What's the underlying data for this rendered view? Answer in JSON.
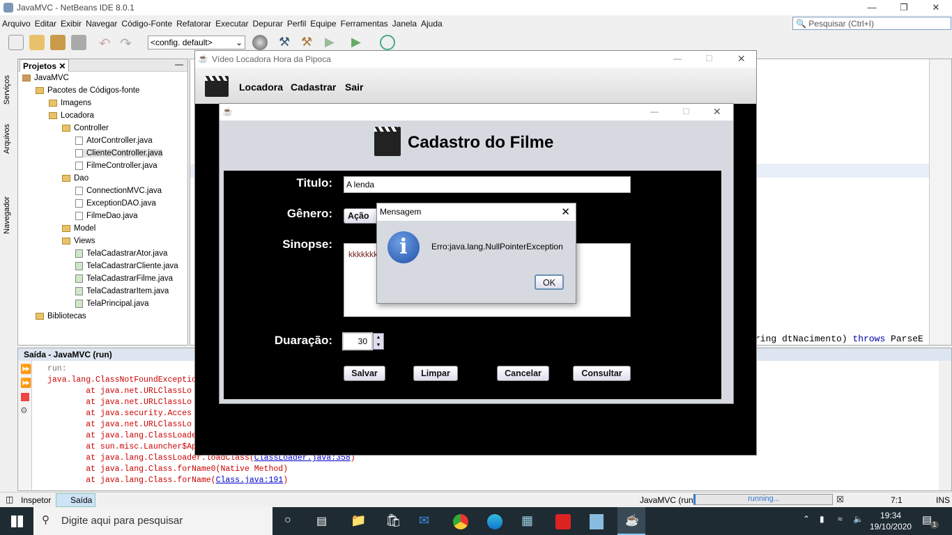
{
  "ide": {
    "title": "JavaMVC - NetBeans IDE 8.0.1",
    "menu": [
      "Arquivo",
      "Editar",
      "Exibir",
      "Navegar",
      "Código-Fonte",
      "Refatorar",
      "Executar",
      "Depurar",
      "Perfil",
      "Equipe",
      "Ferramentas",
      "Janela",
      "Ajuda"
    ],
    "config": "<config. default>",
    "search_placeholder": "Pesquisar (Ctrl+I)",
    "side_tabs": [
      "Serviços",
      "Arquivos",
      "Navegador"
    ]
  },
  "projects": {
    "tab": "Projetos",
    "tree": [
      {
        "label": "JavaMVC",
        "level": 0,
        "type": "project"
      },
      {
        "label": "Pacotes de Códigos-fonte",
        "level": 1,
        "type": "folder"
      },
      {
        "label": "Imagens",
        "level": 2,
        "type": "folder"
      },
      {
        "label": "Locadora",
        "level": 2,
        "type": "folder"
      },
      {
        "label": "Controller",
        "level": 3,
        "type": "folder"
      },
      {
        "label": "AtorController.java",
        "level": 4,
        "type": "file"
      },
      {
        "label": "ClienteController.java",
        "level": 4,
        "type": "file"
      },
      {
        "label": "FilmeController.java",
        "level": 4,
        "type": "file"
      },
      {
        "label": "Dao",
        "level": 3,
        "type": "folder"
      },
      {
        "label": "ConnectionMVC.java",
        "level": 4,
        "type": "file"
      },
      {
        "label": "ExceptionDAO.java",
        "level": 4,
        "type": "file"
      },
      {
        "label": "FilmeDao.java",
        "level": 4,
        "type": "file"
      },
      {
        "label": "Model",
        "level": 3,
        "type": "folder"
      },
      {
        "label": "Views",
        "level": 3,
        "type": "folder"
      },
      {
        "label": "TelaCadastrarAtor.java",
        "level": 4,
        "type": "form"
      },
      {
        "label": "TelaCadastrarCliente.java",
        "level": 4,
        "type": "form"
      },
      {
        "label": "TelaCadastrarFilme.java",
        "level": 4,
        "type": "form"
      },
      {
        "label": "TelaCadastrarItem.java",
        "level": 4,
        "type": "form"
      },
      {
        "label": "TelaPrincipal.java",
        "level": 4,
        "type": "form"
      },
      {
        "label": "Bibliotecas",
        "level": 1,
        "type": "folder"
      }
    ]
  },
  "editor": {
    "code_fragment_1": "ring dtNacimento) ",
    "code_keyword": "throws",
    "code_fragment_2": " ParseE"
  },
  "output": {
    "title": "Saída - JavaMVC (run)",
    "lines": [
      {
        "text": "run:",
        "indent": false,
        "gray": true
      },
      {
        "text": "java.lang.ClassNotFoundExceptio",
        "indent": false
      },
      {
        "text": "at java.net.URLClassLo",
        "indent": true
      },
      {
        "text": "at java.net.URLClassLo",
        "indent": true
      },
      {
        "text": "at java.security.Acces",
        "indent": true
      },
      {
        "text": "at java.net.URLClassLo",
        "indent": true
      },
      {
        "text": "at java.lang.ClassLoade",
        "indent": true
      },
      {
        "text": "at sun.misc.Launcher$Ap",
        "indent": true
      },
      {
        "text": "at java.lang.ClassLoader.loadClass(",
        "link": "ClassLoader.java:358",
        "end": ")",
        "indent": true
      },
      {
        "text": "at java.lang.Class.forName0(Native Method)",
        "indent": true
      },
      {
        "text": "at java.lang.Class.forName(",
        "link": "Class.java:191",
        "end": ")",
        "indent": true
      }
    ]
  },
  "status": {
    "inspector": "Inspetor",
    "output": "Saída",
    "task": "JavaMVC (run)",
    "progress": "running...",
    "position": "7:1",
    "mode": "INS"
  },
  "mainwin": {
    "title": "Vídeo Locadora Hora da Pipoca",
    "menu": [
      "Locadora",
      "Cadastrar",
      "Sair"
    ]
  },
  "cadastro": {
    "heading": "Cadastro do Filme",
    "titulo_label": "Titulo:",
    "titulo_value": "A lenda",
    "genero_label": "Gênero:",
    "genero_value": "Ação",
    "sinopse_label": "Sinopse:",
    "sinopse_value": "kkkkkkk",
    "duracao_label": "Duaração:",
    "duracao_value": "30",
    "buttons": [
      "Salvar",
      "Limpar",
      "Cancelar",
      "Consultar"
    ]
  },
  "dialog": {
    "title": "Mensagem",
    "message": "Erro:java.lang.NullPointerException",
    "ok": "OK"
  },
  "taskbar": {
    "search": "Digite aqui para pesquisar",
    "time": "19:34",
    "date": "19/10/2020",
    "notifications": "1"
  }
}
